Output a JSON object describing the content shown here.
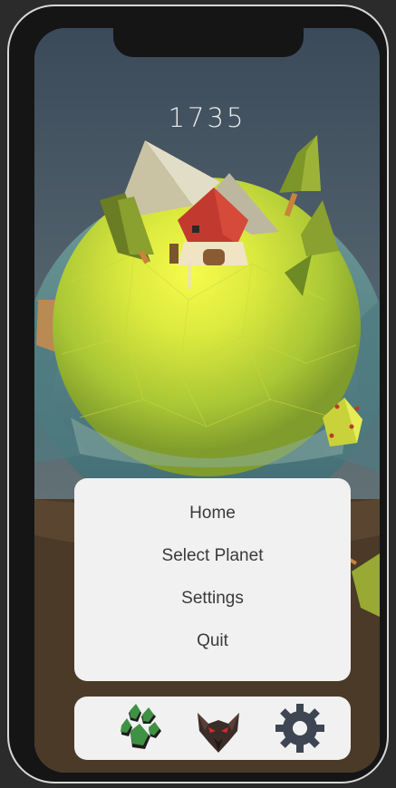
{
  "game": {
    "score": "1735",
    "menu": {
      "items": [
        {
          "label": "Home"
        },
        {
          "label": "Select Planet"
        },
        {
          "label": "Settings"
        },
        {
          "label": "Quit"
        }
      ]
    },
    "dock": {
      "buttons": [
        {
          "icon": "paw-icon"
        },
        {
          "icon": "wolf-head-icon"
        },
        {
          "icon": "gear-icon"
        }
      ]
    }
  }
}
